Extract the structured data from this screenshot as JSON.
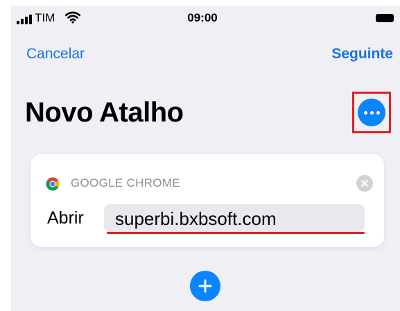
{
  "status_bar": {
    "carrier": "TIM",
    "time": "09:00"
  },
  "nav": {
    "cancel_label": "Cancelar",
    "next_label": "Seguinte"
  },
  "page": {
    "title": "Novo Atalho"
  },
  "action_card": {
    "app_name": "GOOGLE CHROME",
    "action_label": "Abrir",
    "url_value": "superbi.bxbsoft.com"
  },
  "colors": {
    "accent": "#0a84ff",
    "link": "#1a73e8",
    "highlight": "#e02020",
    "background": "#efeff4"
  },
  "icons": {
    "signal": "signal-icon",
    "wifi": "wifi-icon",
    "battery": "battery-icon",
    "more": "more-icon",
    "app": "chrome-icon",
    "remove": "close-icon",
    "add": "plus-icon"
  }
}
